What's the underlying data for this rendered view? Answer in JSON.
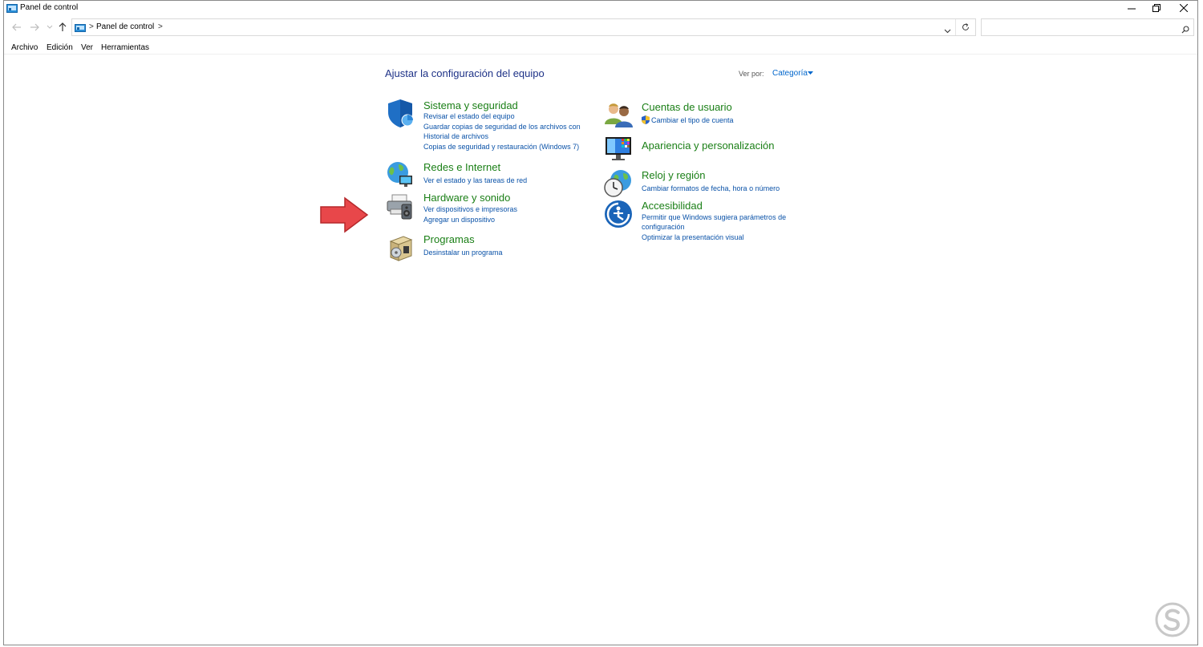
{
  "window": {
    "title": "Panel de control"
  },
  "address": {
    "separator": ">",
    "crumb": "Panel de control",
    "trailing_separator": ">"
  },
  "search": {
    "placeholder": ""
  },
  "menu": {
    "items": [
      "Archivo",
      "Edición",
      "Ver",
      "Herramientas"
    ]
  },
  "content": {
    "heading": "Ajustar la configuración del equipo",
    "view_by_label": "Ver por:",
    "view_by_value": "Categoría"
  },
  "categories": {
    "system": {
      "title": "Sistema y seguridad",
      "links": [
        "Revisar el estado del equipo",
        "Guardar copias de seguridad de los archivos con",
        "Historial de archivos",
        "Copias de seguridad y restauración (Windows 7)"
      ]
    },
    "network": {
      "title": "Redes e Internet",
      "links": [
        "Ver el estado y las tareas de red"
      ]
    },
    "hardware": {
      "title": "Hardware y sonido",
      "links": [
        "Ver dispositivos e impresoras",
        "Agregar un dispositivo"
      ]
    },
    "programs": {
      "title": "Programas",
      "links": [
        "Desinstalar un programa"
      ]
    },
    "users": {
      "title": "Cuentas de usuario",
      "links": [
        "Cambiar el tipo de cuenta"
      ]
    },
    "appearance": {
      "title": "Apariencia y personalización",
      "links": []
    },
    "clock": {
      "title": "Reloj y región",
      "links": [
        "Cambiar formatos de fecha, hora o número"
      ]
    },
    "accessibility": {
      "title": "Accesibilidad",
      "links": [
        "Permitir que Windows sugiera parámetros de",
        "configuración",
        "Optimizar la presentación visual"
      ]
    }
  },
  "colors": {
    "category_title": "#1a7f16",
    "link": "#0a52a8",
    "heading": "#1e3287",
    "annotation_arrow": "#e8474a"
  },
  "icons": {
    "system": "shield-icon",
    "network": "globe-network-icon",
    "hardware": "printer-speaker-icon",
    "programs": "programs-box-icon",
    "users": "users-icon",
    "appearance": "monitor-palette-icon",
    "clock": "clock-globe-icon",
    "accessibility": "accessibility-icon"
  }
}
